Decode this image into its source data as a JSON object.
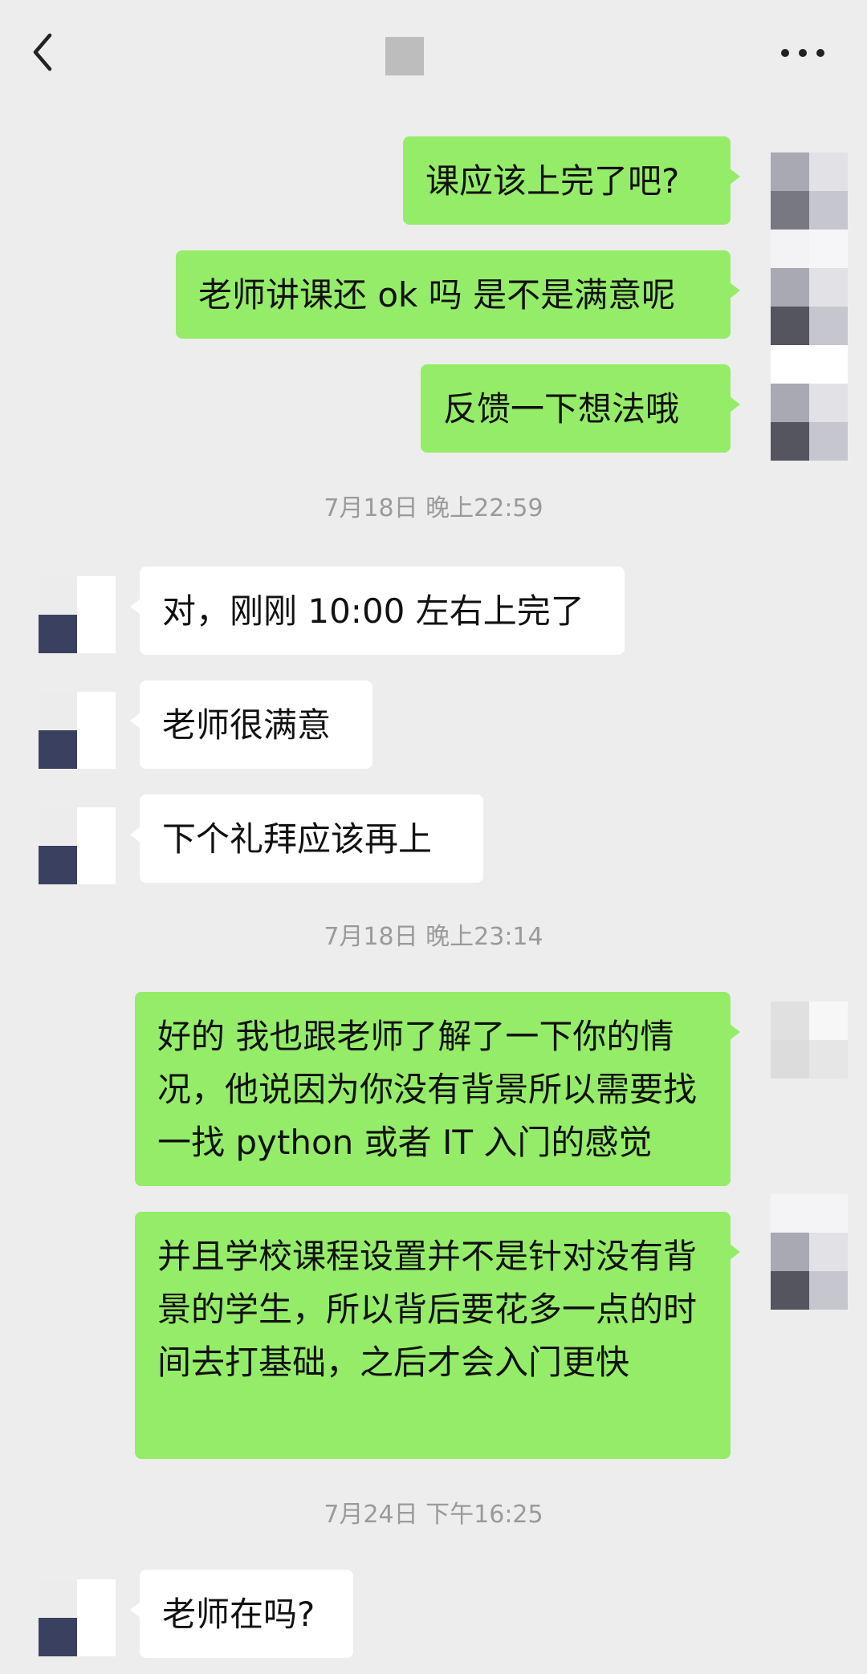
{
  "header": {
    "back_icon": "chevron-left-icon",
    "more_icon": "more-horizontal-icon"
  },
  "messages": [
    {
      "direction": "out",
      "text": "课应该上完了吧?"
    },
    {
      "direction": "out",
      "text": "老师讲课还 ok 吗 是不是满意呢"
    },
    {
      "direction": "out",
      "text": "反馈一下想法哦"
    },
    {
      "type": "timestamp",
      "text": "7月18日 晚上22:59"
    },
    {
      "direction": "in",
      "text": "对，刚刚 10:00 左右上完了"
    },
    {
      "direction": "in",
      "text": "老师很满意"
    },
    {
      "direction": "in",
      "text": "下个礼拜应该再上"
    },
    {
      "type": "timestamp",
      "text": "7月18日 晚上23:14"
    },
    {
      "direction": "out",
      "text": "好的 我也跟老师了解了一下你的情况，他说因为你没有背景所以需要找一找 python 或者 IT 入门的感觉"
    },
    {
      "direction": "out",
      "text": "并且学校课程设置并不是针对没有背景的学生，所以背后要花多一点的时间去打基础，之后才会入门更快"
    },
    {
      "type": "timestamp",
      "text": "7月24日 下午16:25"
    },
    {
      "direction": "in",
      "text": "老师在吗?"
    }
  ],
  "colors": {
    "background": "#ededed",
    "outgoing_bubble": "#95ec69",
    "incoming_bubble": "#ffffff",
    "timestamp_text": "#9a9a9a"
  }
}
